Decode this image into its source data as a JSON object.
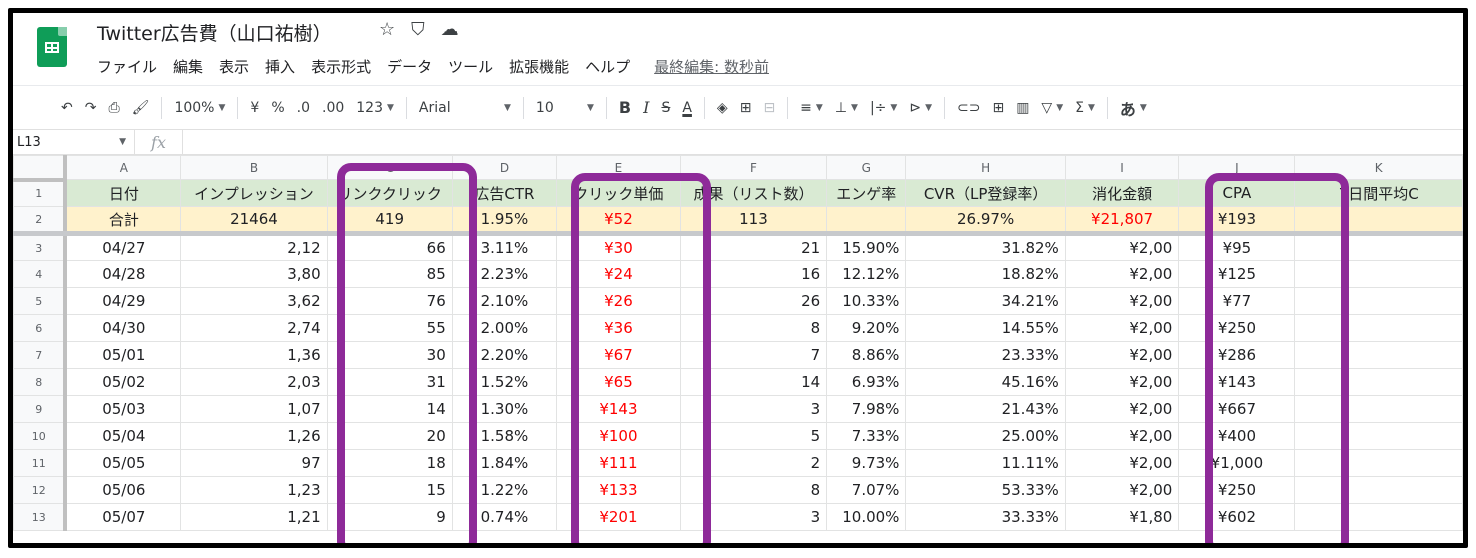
{
  "app": {
    "title": "Twitter広告費（山口祐樹）",
    "menu": [
      "ファイル",
      "編集",
      "表示",
      "挿入",
      "表示形式",
      "データ",
      "ツール",
      "拡張機能",
      "ヘルプ"
    ],
    "last_edit": "最終編集: 数秒前"
  },
  "toolbar": {
    "undo": "↶",
    "redo": "↷",
    "print": "⎙",
    "paint": "🖌",
    "zoom": "100%",
    "currency": "¥",
    "percent": "%",
    "dec_less": ".0",
    "dec_more": ".00",
    "format": "123",
    "font": "Arial",
    "size": "10",
    "bold": "B",
    "italic": "I",
    "strike": "S",
    "textcolor": "A",
    "fill": "◈",
    "borders": "⊞",
    "merge": "⊟",
    "halign": "≡",
    "valign": "⊥",
    "wrap": "|÷",
    "rotate": "⊳",
    "link": "⊂⊃",
    "comment": "⊞",
    "chart": "▥",
    "filter": "▽",
    "functions": "Σ",
    "input": "あ"
  },
  "formula_bar": {
    "cell_ref": "L13",
    "fx": "fx",
    "value": ""
  },
  "columns": [
    "A",
    "B",
    "C",
    "D",
    "E",
    "F",
    "G",
    "H",
    "I",
    "J",
    "K"
  ],
  "header_row": {
    "num": "1",
    "cells": [
      "日付",
      "インプレッション",
      "リンククリック",
      "広告CTR",
      "クリック単価",
      "成果（リスト数）",
      "エンゲ率",
      "CVR（LP登録率）",
      "消化金額",
      "CPA",
      "7日間平均C"
    ]
  },
  "total_row": {
    "num": "2",
    "cells": [
      "合計",
      "21464",
      "419",
      "1.95%",
      "¥52",
      "113",
      "",
      "26.97%",
      "¥21,807",
      "¥193",
      ""
    ]
  },
  "rows": [
    {
      "num": "3",
      "cells": [
        "04/27",
        "2,12",
        "66",
        "3.11%",
        "¥30",
        "21",
        "15.90%",
        "31.82%",
        "¥2,00",
        "¥95",
        ""
      ]
    },
    {
      "num": "4",
      "cells": [
        "04/28",
        "3,80",
        "85",
        "2.23%",
        "¥24",
        "16",
        "12.12%",
        "18.82%",
        "¥2,00",
        "¥125",
        ""
      ]
    },
    {
      "num": "5",
      "cells": [
        "04/29",
        "3,62",
        "76",
        "2.10%",
        "¥26",
        "26",
        "10.33%",
        "34.21%",
        "¥2,00",
        "¥77",
        ""
      ]
    },
    {
      "num": "6",
      "cells": [
        "04/30",
        "2,74",
        "55",
        "2.00%",
        "¥36",
        "8",
        "9.20%",
        "14.55%",
        "¥2,00",
        "¥250",
        ""
      ]
    },
    {
      "num": "7",
      "cells": [
        "05/01",
        "1,36",
        "30",
        "2.20%",
        "¥67",
        "7",
        "8.86%",
        "23.33%",
        "¥2,00",
        "¥286",
        ""
      ]
    },
    {
      "num": "8",
      "cells": [
        "05/02",
        "2,03",
        "31",
        "1.52%",
        "¥65",
        "14",
        "6.93%",
        "45.16%",
        "¥2,00",
        "¥143",
        ""
      ]
    },
    {
      "num": "9",
      "cells": [
        "05/03",
        "1,07",
        "14",
        "1.30%",
        "¥143",
        "3",
        "7.98%",
        "21.43%",
        "¥2,00",
        "¥667",
        ""
      ]
    },
    {
      "num": "10",
      "cells": [
        "05/04",
        "1,26",
        "20",
        "1.58%",
        "¥100",
        "5",
        "7.33%",
        "25.00%",
        "¥2,00",
        "¥400",
        ""
      ]
    },
    {
      "num": "11",
      "cells": [
        "05/05",
        "97",
        "18",
        "1.84%",
        "¥111",
        "2",
        "9.73%",
        "11.11%",
        "¥2,00",
        "¥1,000",
        ""
      ]
    },
    {
      "num": "12",
      "cells": [
        "05/06",
        "1,23",
        "15",
        "1.22%",
        "¥133",
        "8",
        "7.07%",
        "53.33%",
        "¥2,00",
        "¥250",
        ""
      ]
    },
    {
      "num": "13",
      "cells": [
        "05/07",
        "1,21",
        "9",
        "0.74%",
        "¥201",
        "3",
        "10.00%",
        "33.33%",
        "¥1,80",
        "¥602",
        ""
      ]
    }
  ],
  "colors": {
    "highlight": "#8e2a99",
    "header_bg": "#d9ead3",
    "total_bg": "#fff2cc",
    "red": "#ff0000",
    "logo": "#0f9d58"
  }
}
